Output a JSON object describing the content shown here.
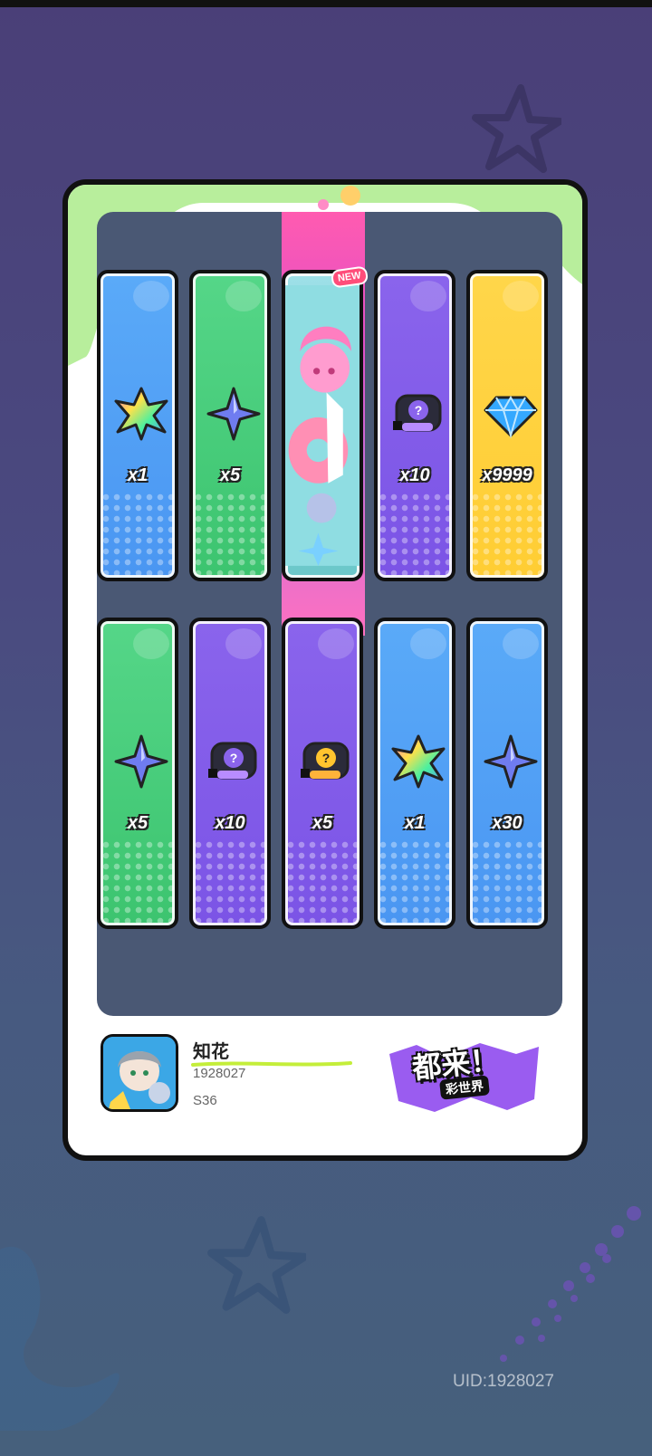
{
  "player": {
    "name": "知花",
    "id": "1928027",
    "season": "S36"
  },
  "logo": {
    "title": "都来！",
    "subtitle": "彩世界"
  },
  "badge": {
    "new": "NEW"
  },
  "uid": "UID:1928027",
  "rewards": [
    {
      "icon": "rainbow-crystal-icon",
      "qty": "x1",
      "color": "blue"
    },
    {
      "icon": "blue-star-shard-icon",
      "qty": "x5",
      "color": "green"
    },
    {
      "icon": "character-card-portrait",
      "qty": "",
      "color": "character"
    },
    {
      "icon": "mystery-ticket-icon",
      "qty": "x10",
      "color": "purple"
    },
    {
      "icon": "diamond-gem-icon",
      "qty": "x9999",
      "color": "yellow"
    },
    {
      "icon": "blue-star-shard-icon",
      "qty": "x5",
      "color": "green"
    },
    {
      "icon": "mystery-ticket-icon",
      "qty": "x10",
      "color": "purple"
    },
    {
      "icon": "gold-mystery-ticket-icon",
      "qty": "x5",
      "color": "purple"
    },
    {
      "icon": "rainbow-crystal-icon",
      "qty": "x1",
      "color": "blue"
    },
    {
      "icon": "blue-star-shard-icon",
      "qty": "x30",
      "color": "blue"
    }
  ],
  "colors": {
    "blue": "#4a96f2",
    "green": "#3cc46f",
    "purple": "#7b54e6",
    "yellow": "#ffcd33",
    "board": "#4a5874"
  }
}
